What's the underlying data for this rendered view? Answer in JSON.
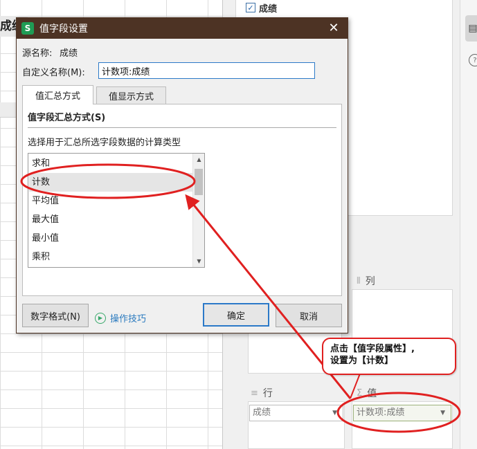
{
  "sheet": {
    "header_cell": "成绩"
  },
  "pane": {
    "field": {
      "label": "成绩",
      "checked": true,
      "check_glyph": "✓"
    },
    "columns_title": "列",
    "rows_title": "行",
    "values_title": "值",
    "rows_select": "成绩",
    "values_select": "计数项:成绩",
    "area_glyph_columns": "⦀",
    "area_glyph_rows": "≡",
    "area_glyph_values": "Σ"
  },
  "dialog": {
    "app_icon_letter": "S",
    "title": "值字段设置",
    "close_symbol": "✕",
    "source_label": "源名称:",
    "source_value": "成绩",
    "custom_name_label": "自定义名称(M):",
    "custom_name_value": "计数项:成绩",
    "tabs": [
      {
        "label": "值汇总方式",
        "active": true
      },
      {
        "label": "值显示方式",
        "active": false
      }
    ],
    "panel_heading": "值字段汇总方式(S)",
    "panel_desc": "选择用于汇总所选字段数据的计算类型",
    "functions": [
      "求和",
      "计数",
      "平均值",
      "最大值",
      "最小值",
      "乘积"
    ],
    "selected_function": "计数",
    "number_format_button": "数字格式(N)",
    "tips_link": "操作技巧",
    "ok_button": "确定",
    "cancel_button": "取消"
  },
  "annotation": {
    "line1": "点击【值字段属性】,",
    "line2": "设置为【计数】",
    "color": "#e02020"
  }
}
